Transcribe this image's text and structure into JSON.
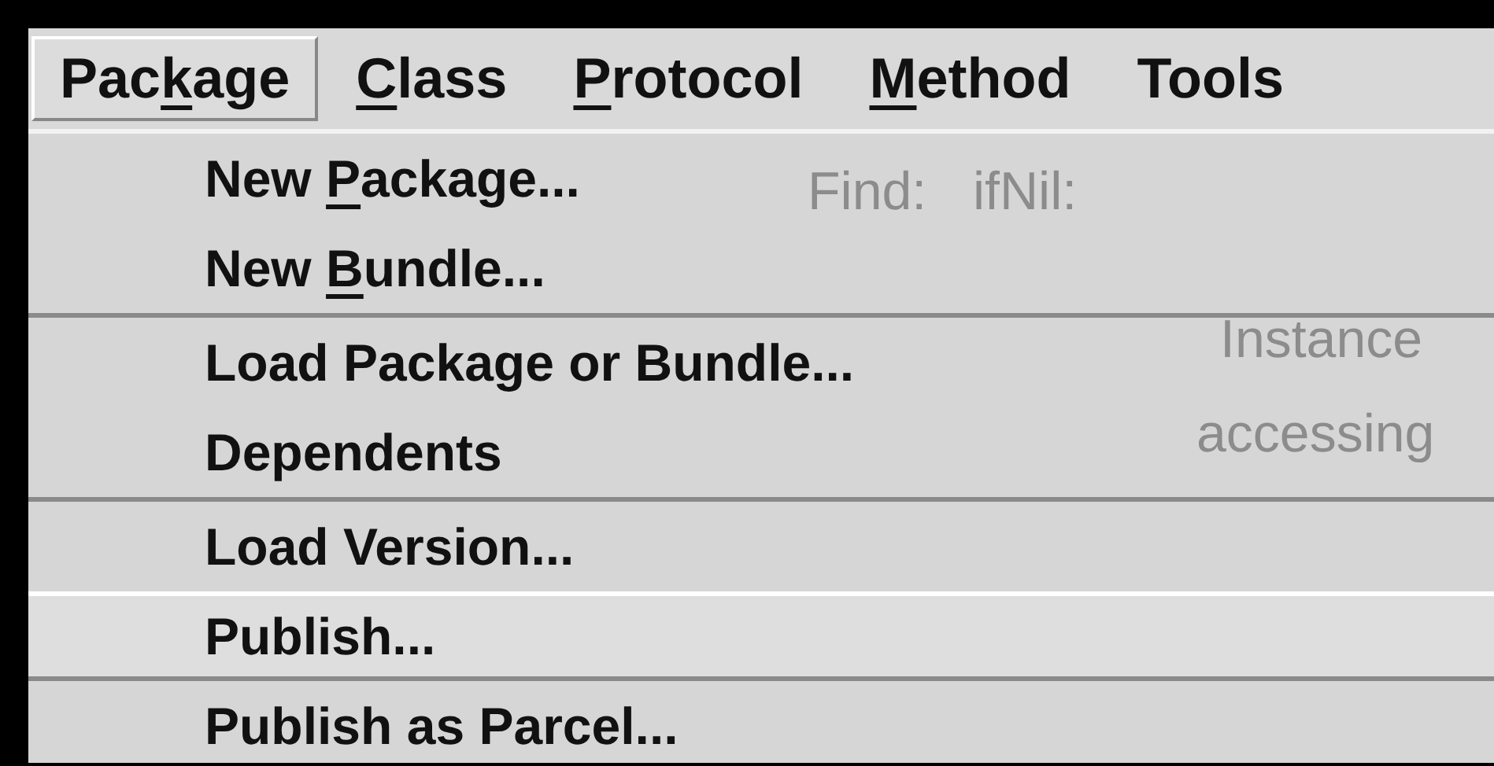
{
  "menu_bar": {
    "menus": [
      {
        "before": "Pac",
        "key": "k",
        "after": "age",
        "selected": true
      },
      {
        "key": "C",
        "after": "lass",
        "selected": false
      },
      {
        "key": "P",
        "after": "rotocol",
        "selected": false
      },
      {
        "key": "M",
        "after": "ethod",
        "selected": false
      },
      {
        "before": "Tools",
        "selected": false
      }
    ]
  },
  "dropdown": {
    "groups": [
      [
        {
          "before": "New ",
          "key": "P",
          "after": "ackage...",
          "selected": false
        },
        {
          "before": "New ",
          "key": "B",
          "after": "undle...",
          "selected": false
        }
      ],
      [
        {
          "before": "Load Package or Bundle...",
          "selected": false
        },
        {
          "before": "Dependents",
          "selected": false
        }
      ],
      [
        {
          "before": "Load Version...",
          "selected": false
        },
        {
          "before": "Publish...",
          "selected": true
        }
      ],
      [
        {
          "before": "Publish as Parcel...",
          "selected": false
        }
      ]
    ]
  },
  "background": {
    "find_label": "Find:",
    "find_value": "ifNil:",
    "panel_title": "Instance",
    "protocol_item": "accessing"
  }
}
